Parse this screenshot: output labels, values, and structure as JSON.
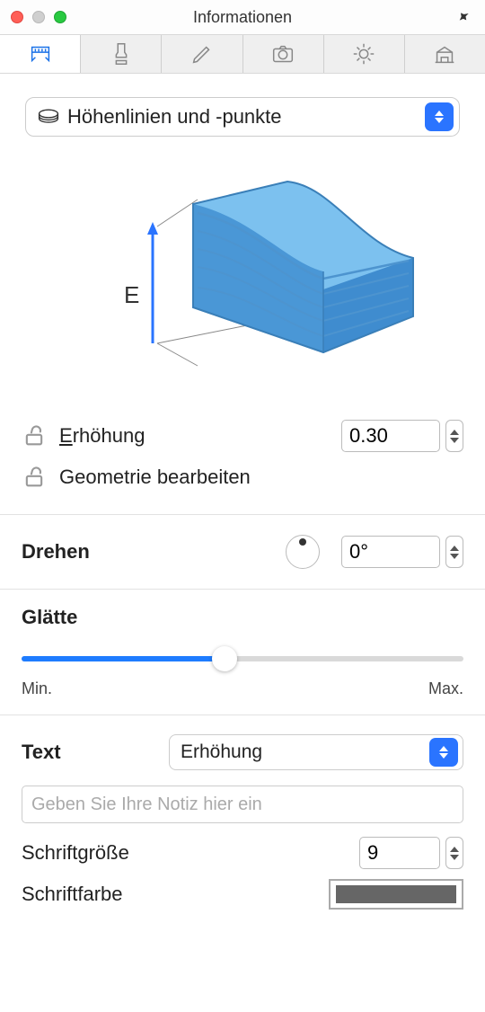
{
  "window": {
    "title": "Informationen"
  },
  "dropdown": {
    "label": "Höhenlinien und -punkte"
  },
  "illustration": {
    "axis_label": "E"
  },
  "elevation": {
    "label": "Erhöhung",
    "value": "0.30"
  },
  "edit_geometry": {
    "label": "Geometrie bearbeiten"
  },
  "rotate": {
    "label": "Drehen",
    "value": "0°"
  },
  "smooth": {
    "label": "Glätte",
    "min_label": "Min.",
    "max_label": "Max.",
    "value": 46
  },
  "text": {
    "label": "Text",
    "select": "Erhöhung",
    "note_placeholder": "Geben Sie Ihre Notiz hier ein",
    "size_label": "Schriftgröße",
    "size_value": "9",
    "color_label": "Schriftfarbe",
    "color_value": "#666666"
  }
}
